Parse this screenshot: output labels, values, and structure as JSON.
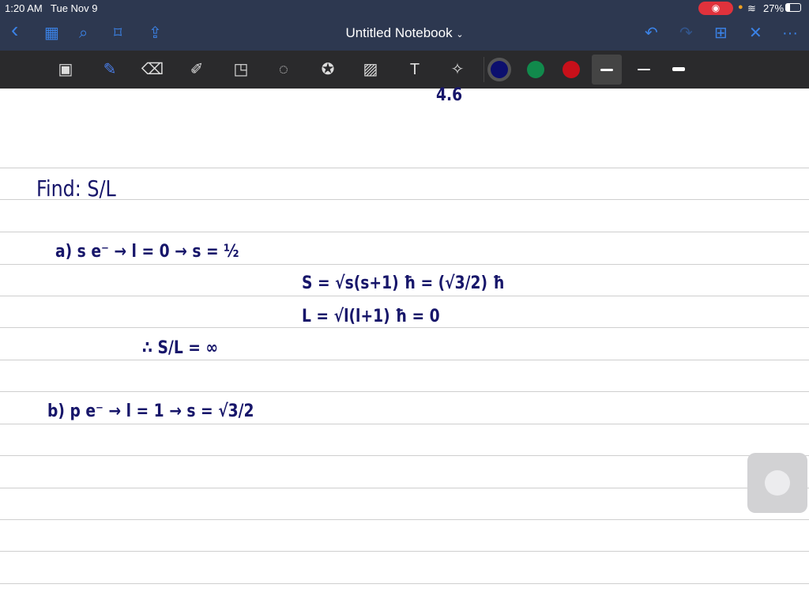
{
  "status_bar": {
    "time": "1:20 AM",
    "date": "Tue Nov 9",
    "battery": "27%"
  },
  "nav": {
    "title": "Untitled Notebook",
    "back": "‹",
    "thumbnails": "▦",
    "search": "⌕",
    "bookmark": "⌑",
    "share": "⇪",
    "undo": "↶",
    "redo": "↷",
    "add_page": "⊞",
    "close": "✕",
    "more": "···"
  },
  "toolbar": {
    "tools": [
      {
        "name": "zoom-window",
        "glyph": "▣"
      },
      {
        "name": "pen",
        "glyph": "✎"
      },
      {
        "name": "eraser",
        "glyph": "⌫"
      },
      {
        "name": "highlighter",
        "glyph": "✐"
      },
      {
        "name": "shapes",
        "glyph": "◳"
      },
      {
        "name": "lasso",
        "glyph": "◌"
      },
      {
        "name": "elements",
        "glyph": "✪"
      },
      {
        "name": "image",
        "glyph": "▨"
      },
      {
        "name": "text",
        "glyph": "T"
      },
      {
        "name": "laser",
        "glyph": "✧"
      }
    ],
    "colors": [
      "#0c0f6e",
      "#118a4c",
      "#c8101a"
    ]
  },
  "note": {
    "top": "4.6",
    "find": "Find:   S/L",
    "a1": "a)   s e⁻ →   l = 0   →   s = ½",
    "a2": "S = √s(s+1) ħ  =  (√3/2) ħ",
    "a3": "L = √l(l+1) ħ  =  0",
    "a4": "∴  S/L = ∞",
    "b1": "b)   p e⁻ →   l = 1   →   s = √3/2"
  }
}
